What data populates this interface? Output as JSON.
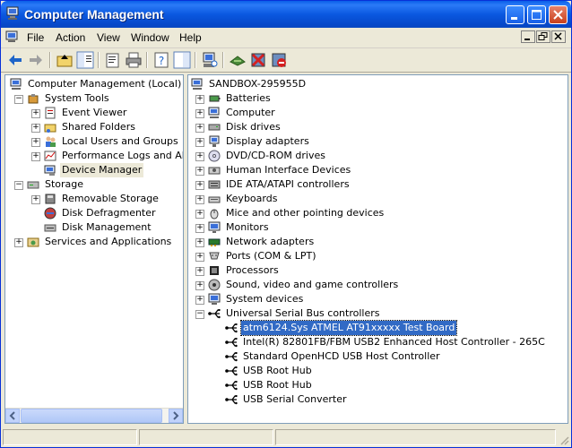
{
  "window": {
    "title": "Computer Management"
  },
  "menu": [
    "File",
    "Action",
    "View",
    "Window",
    "Help"
  ],
  "left_tree": [
    {
      "label": "Computer Management (Local)",
      "level": 0,
      "expander": "",
      "icon": "computer-management-icon"
    },
    {
      "label": "System Tools",
      "level": 1,
      "expander": "−",
      "icon": "system-tools-icon"
    },
    {
      "label": "Event Viewer",
      "level": 2,
      "expander": "+",
      "icon": "event-viewer-icon"
    },
    {
      "label": "Shared Folders",
      "level": 2,
      "expander": "+",
      "icon": "shared-folders-icon"
    },
    {
      "label": "Local Users and Groups",
      "level": 2,
      "expander": "+",
      "icon": "users-groups-icon"
    },
    {
      "label": "Performance Logs and Alerts",
      "level": 2,
      "expander": "+",
      "icon": "performance-logs-icon"
    },
    {
      "label": "Device Manager",
      "level": 2,
      "expander": "",
      "icon": "device-manager-icon",
      "selected": true
    },
    {
      "label": "Storage",
      "level": 1,
      "expander": "−",
      "icon": "storage-icon"
    },
    {
      "label": "Removable Storage",
      "level": 2,
      "expander": "+",
      "icon": "removable-storage-icon"
    },
    {
      "label": "Disk Defragmenter",
      "level": 2,
      "expander": "",
      "icon": "disk-defragmenter-icon"
    },
    {
      "label": "Disk Management",
      "level": 2,
      "expander": "",
      "icon": "disk-management-icon"
    },
    {
      "label": "Services and Applications",
      "level": 1,
      "expander": "+",
      "icon": "services-applications-icon"
    }
  ],
  "right_tree": [
    {
      "label": "SANDBOX-295955D",
      "level": 0,
      "expander": "",
      "icon": "computer-icon"
    },
    {
      "label": "Batteries",
      "level": 1,
      "expander": "+",
      "icon": "battery-icon"
    },
    {
      "label": "Computer",
      "level": 1,
      "expander": "+",
      "icon": "computer-icon"
    },
    {
      "label": "Disk drives",
      "level": 1,
      "expander": "+",
      "icon": "disk-drive-icon"
    },
    {
      "label": "Display adapters",
      "level": 1,
      "expander": "+",
      "icon": "display-adapter-icon"
    },
    {
      "label": "DVD/CD-ROM drives",
      "level": 1,
      "expander": "+",
      "icon": "cdrom-icon"
    },
    {
      "label": "Human Interface Devices",
      "level": 1,
      "expander": "+",
      "icon": "hid-icon"
    },
    {
      "label": "IDE ATA/ATAPI controllers",
      "level": 1,
      "expander": "+",
      "icon": "ide-controller-icon"
    },
    {
      "label": "Keyboards",
      "level": 1,
      "expander": "+",
      "icon": "keyboard-icon"
    },
    {
      "label": "Mice and other pointing devices",
      "level": 1,
      "expander": "+",
      "icon": "mouse-icon"
    },
    {
      "label": "Monitors",
      "level": 1,
      "expander": "+",
      "icon": "monitor-icon"
    },
    {
      "label": "Network adapters",
      "level": 1,
      "expander": "+",
      "icon": "network-adapter-icon"
    },
    {
      "label": "Ports (COM & LPT)",
      "level": 1,
      "expander": "+",
      "icon": "port-icon"
    },
    {
      "label": "Processors",
      "level": 1,
      "expander": "+",
      "icon": "processor-icon"
    },
    {
      "label": "Sound, video and game controllers",
      "level": 1,
      "expander": "+",
      "icon": "sound-icon"
    },
    {
      "label": "System devices",
      "level": 1,
      "expander": "+",
      "icon": "system-devices-icon"
    },
    {
      "label": "Universal Serial Bus controllers",
      "level": 1,
      "expander": "−",
      "icon": "usb-icon"
    },
    {
      "label": "atm6124.Sys ATMEL AT91xxxxx Test Board",
      "level": 2,
      "expander": "",
      "icon": "usb-icon",
      "selected": true
    },
    {
      "label": "Intel(R) 82801FB/FBM USB2 Enhanced Host Controller - 265C",
      "level": 2,
      "expander": "",
      "icon": "usb-icon"
    },
    {
      "label": "Standard OpenHCD USB Host Controller",
      "level": 2,
      "expander": "",
      "icon": "usb-icon"
    },
    {
      "label": "USB Root Hub",
      "level": 2,
      "expander": "",
      "icon": "usb-icon"
    },
    {
      "label": "USB Root Hub",
      "level": 2,
      "expander": "",
      "icon": "usb-icon"
    },
    {
      "label": "USB Serial Converter",
      "level": 2,
      "expander": "",
      "icon": "usb-icon"
    }
  ],
  "colors": {
    "selection": "#316ac5",
    "titlebar": "#0a58e0",
    "face": "#ece9d8"
  }
}
